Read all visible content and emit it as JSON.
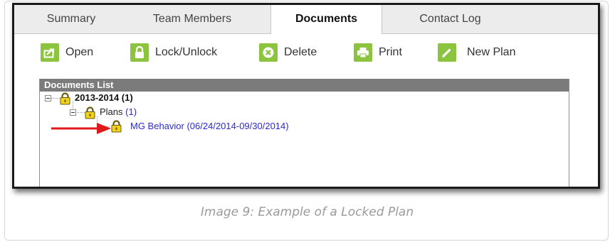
{
  "tabs": [
    {
      "label": "Summary",
      "active": false
    },
    {
      "label": "Team Members",
      "active": false
    },
    {
      "label": "Documents",
      "active": true
    },
    {
      "label": "Contact Log",
      "active": false
    }
  ],
  "toolbar": {
    "open_label": "Open",
    "lock_label": "Lock/Unlock",
    "delete_label": "Delete",
    "print_label": "Print",
    "new_plan_label": "New Plan",
    "accent": "#8cc43f"
  },
  "documents_list": {
    "title": "Documents List",
    "year_label": "2013-2014 (1)",
    "plans_label": "Plans",
    "plans_count": "(1)",
    "plan_label": "MG Behavior (06/24/2014-09/30/2014)"
  },
  "colors": {
    "link": "#2a2ad0",
    "arrow": "#e01a1a",
    "lock": "#f2d21a"
  },
  "caption": "Image 9: Example of a Locked Plan"
}
